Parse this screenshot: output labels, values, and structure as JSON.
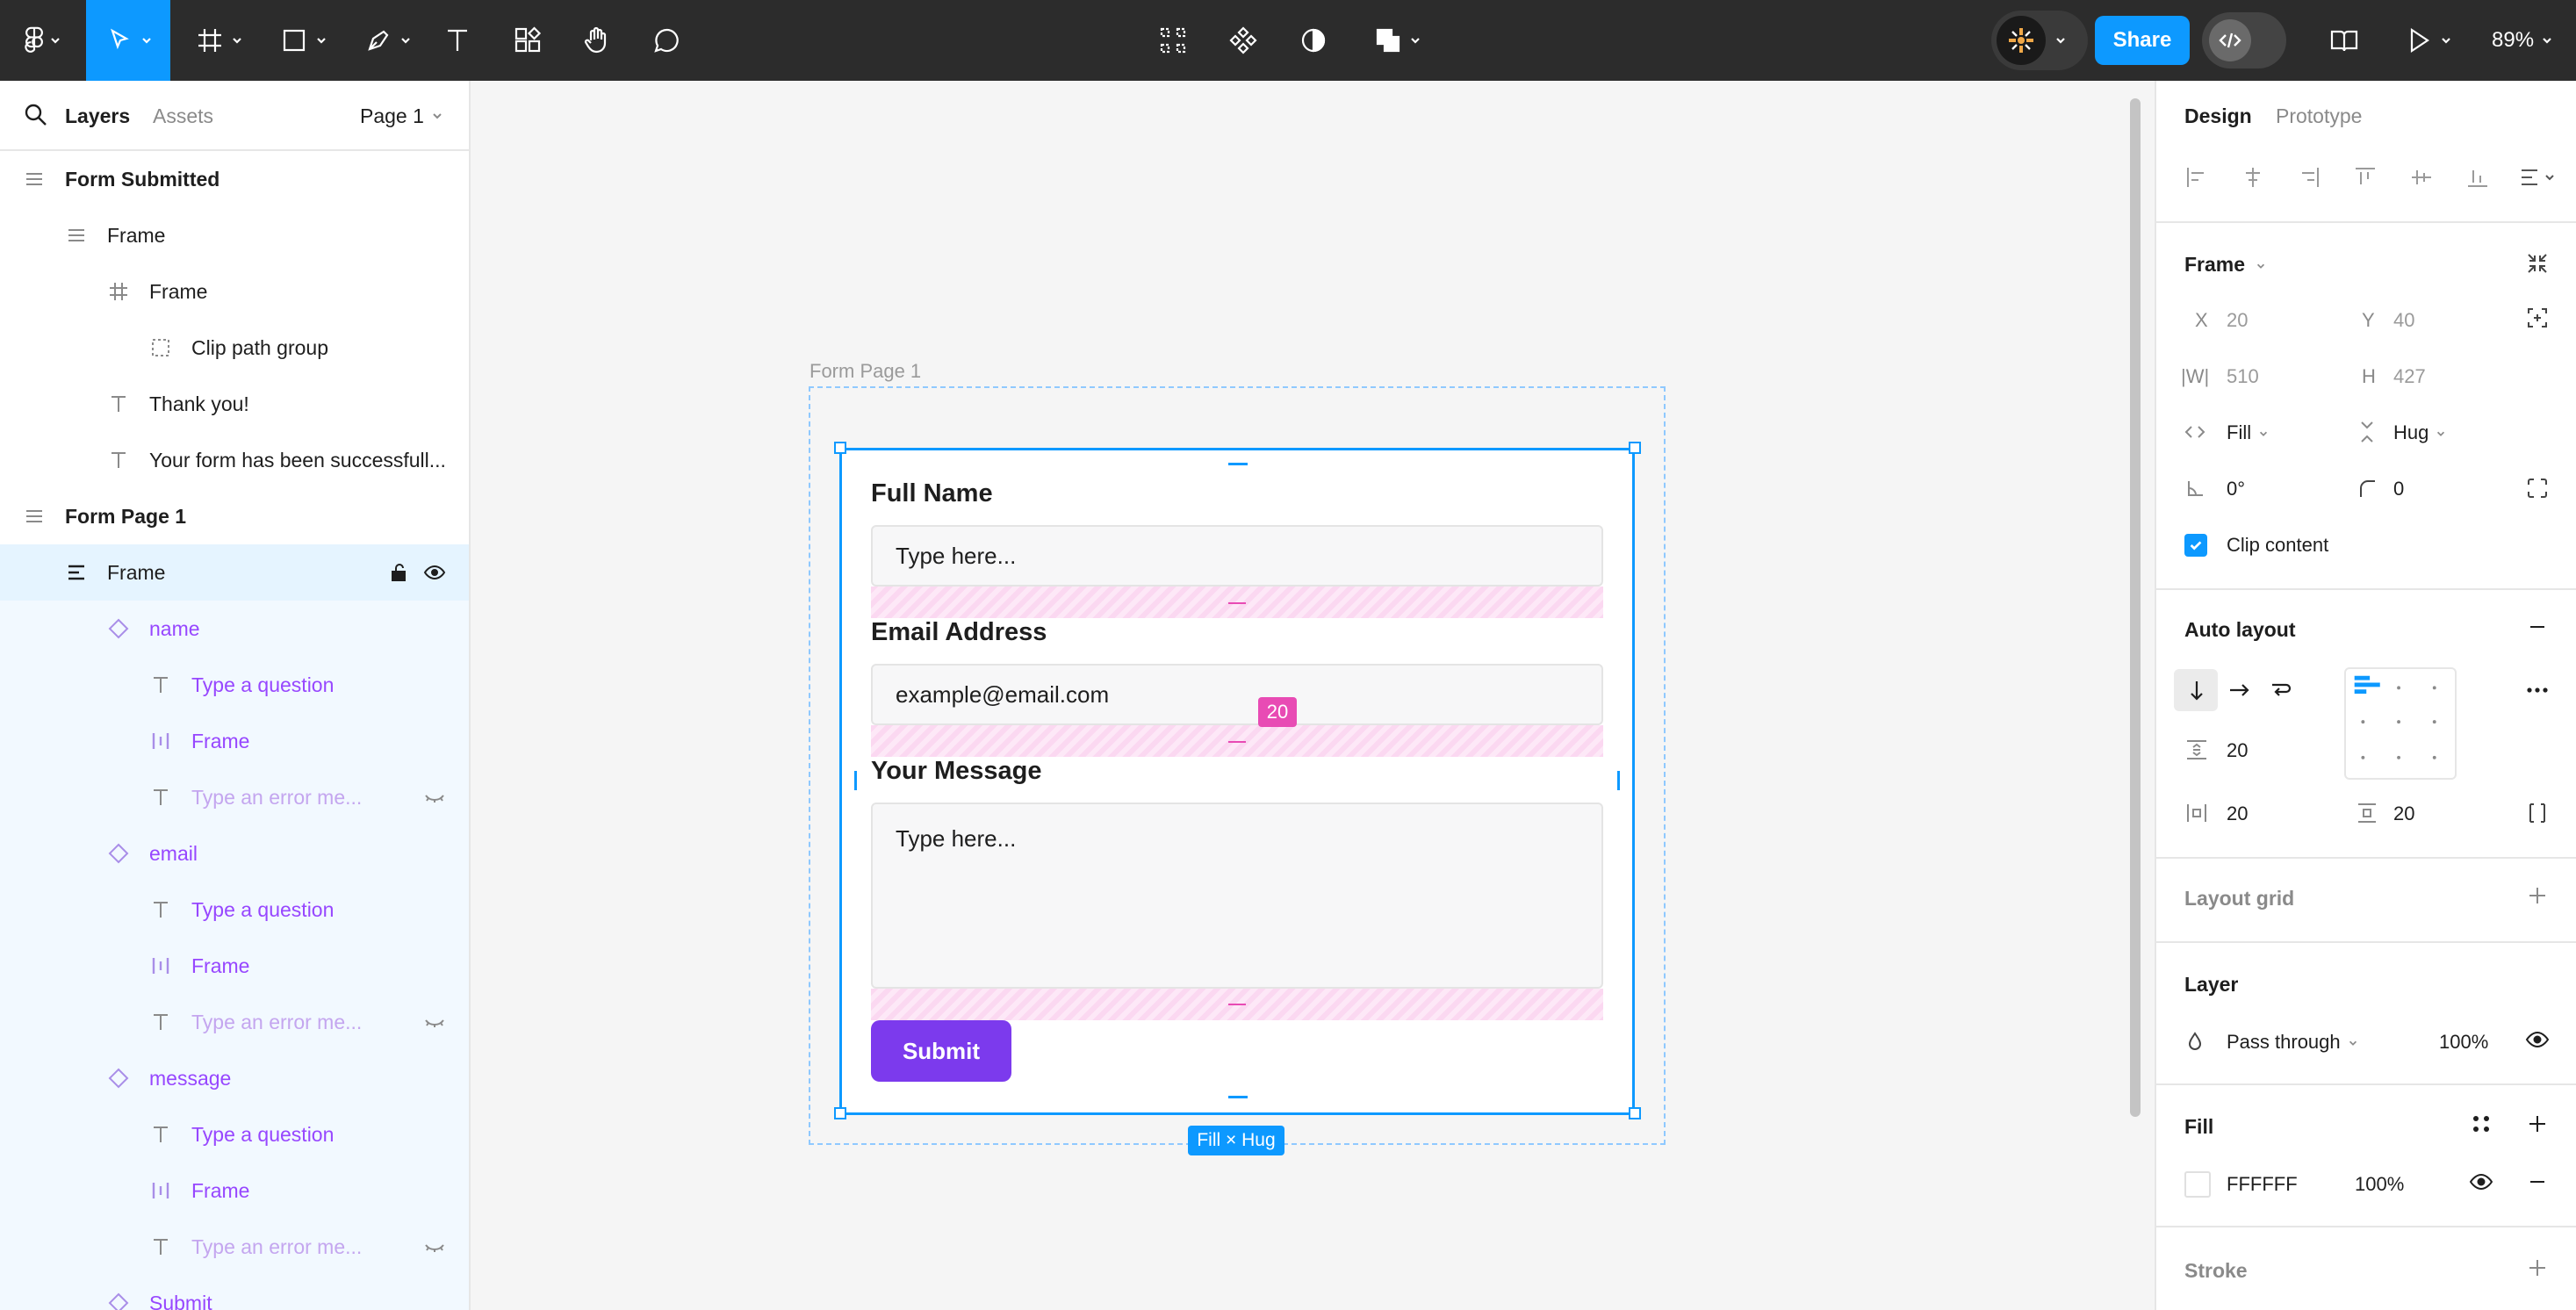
{
  "toolbar": {
    "share_label": "Share",
    "zoom": "89%"
  },
  "left_panel": {
    "tabs": {
      "layers": "Layers",
      "assets": "Assets"
    },
    "page": "Page 1",
    "layers": [
      {
        "label": "Form Submitted",
        "icon": "frame-lines"
      },
      {
        "label": "Frame",
        "icon": "lines"
      },
      {
        "label": "Frame",
        "icon": "hash"
      },
      {
        "label": "Clip path group",
        "icon": "dashed-square"
      },
      {
        "label": "Thank you!",
        "icon": "text"
      },
      {
        "label": "Your form has been successfull...",
        "icon": "text"
      },
      {
        "label": "Form Page 1",
        "icon": "frame-lines"
      },
      {
        "label": "Frame",
        "icon": "auto-layout"
      },
      {
        "label": "name",
        "icon": "diamond"
      },
      {
        "label": "Type a question",
        "icon": "text"
      },
      {
        "label": "Frame",
        "icon": "auto-layout-h"
      },
      {
        "label": "Type an error me...",
        "icon": "text"
      },
      {
        "label": "email",
        "icon": "diamond"
      },
      {
        "label": "Type a question",
        "icon": "text"
      },
      {
        "label": "Frame",
        "icon": "auto-layout-h"
      },
      {
        "label": "Type an error me...",
        "icon": "text"
      },
      {
        "label": "message",
        "icon": "diamond"
      },
      {
        "label": "Type a question",
        "icon": "text"
      },
      {
        "label": "Frame",
        "icon": "auto-layout-h"
      },
      {
        "label": "Type an error me...",
        "icon": "text"
      },
      {
        "label": "Submit",
        "icon": "diamond"
      }
    ]
  },
  "canvas": {
    "frame_label": "Form Page 1",
    "form": {
      "full_name_label": "Full Name",
      "full_name_placeholder": "Type here...",
      "email_label": "Email Address",
      "email_placeholder": "example@email.com",
      "message_label": "Your Message",
      "message_placeholder": "Type here...",
      "submit_label": "Submit"
    },
    "gap_badge": "20",
    "size_badge": "Fill × Hug"
  },
  "right_panel": {
    "tabs": {
      "design": "Design",
      "prototype": "Prototype"
    },
    "frame": {
      "title": "Frame",
      "x_label": "X",
      "x": "20",
      "y_label": "Y",
      "y": "40",
      "w_label": "|W|",
      "w": "510",
      "h_label": "H",
      "h": "427",
      "horizontal_sizing": "Fill",
      "vertical_sizing": "Hug",
      "rotation": "0°",
      "radius": "0",
      "clip_content": "Clip content"
    },
    "auto_layout": {
      "title": "Auto layout",
      "gap": "20",
      "padding_h": "20",
      "padding_v": "20"
    },
    "layout_grid": {
      "title": "Layout grid"
    },
    "layer": {
      "title": "Layer",
      "blend": "Pass through",
      "opacity": "100%"
    },
    "fill": {
      "title": "Fill",
      "hex": "FFFFFF",
      "opacity": "100%"
    },
    "stroke": {
      "title": "Stroke"
    }
  },
  "colors": {
    "accent": "#0d99ff",
    "component": "#9747ff",
    "submit": "#7c3aed",
    "spacing": "#e84bb4"
  }
}
